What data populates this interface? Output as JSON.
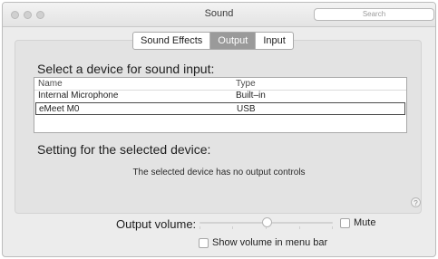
{
  "window": {
    "title": "Sound"
  },
  "search": {
    "placeholder": "Search"
  },
  "tabs": [
    {
      "label": "Sound Effects",
      "selected": false
    },
    {
      "label": "Output",
      "selected": true
    },
    {
      "label": "Input",
      "selected": false
    }
  ],
  "input_section": {
    "heading": "Select a device for sound input:",
    "columns": [
      "Name",
      "Type"
    ],
    "rows": [
      {
        "name": "Internal Microphone",
        "type": "Built–in",
        "selected": false
      },
      {
        "name": "eMeet M0",
        "type": "USB",
        "selected": true
      }
    ]
  },
  "settings_section": {
    "heading": "Setting for the selected device:",
    "note": "The selected device has no output controls"
  },
  "help": {
    "glyph": "?"
  },
  "volume": {
    "label": "Output volume:",
    "level_fraction": 0.5,
    "mute_label": "Mute",
    "mute_checked": false
  },
  "menu_bar": {
    "label": "Show volume in menu bar",
    "checked": false
  },
  "colors": {
    "selected_tab_bg": "#9a9a9a",
    "selected_row_border": "#4c4c4c"
  }
}
